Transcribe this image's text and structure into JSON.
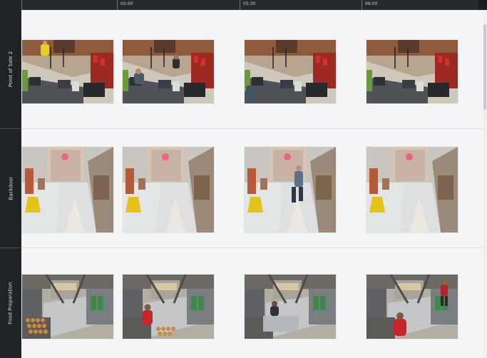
{
  "timeline": {
    "ticks": [
      {
        "label": ""
      },
      {
        "label": "05:00"
      },
      {
        "label": "05:30"
      },
      {
        "label": "06:00"
      }
    ]
  },
  "lanes": [
    {
      "label": "Point of Sale 2",
      "thumbnails": [
        {
          "scene": "point-of-sale",
          "people": [
            "yellow-shirt-customer"
          ]
        },
        {
          "scene": "point-of-sale",
          "people": [
            "cashier",
            "customer"
          ]
        },
        {
          "scene": "point-of-sale",
          "people": [
            "cashier-partial"
          ]
        },
        {
          "scene": "point-of-sale",
          "people": []
        }
      ]
    },
    {
      "label": "Backdoor",
      "thumbnails": [
        {
          "scene": "backdoor",
          "people": []
        },
        {
          "scene": "backdoor",
          "people": []
        },
        {
          "scene": "backdoor",
          "people": [
            "worker-walking"
          ]
        },
        {
          "scene": "backdoor",
          "people": []
        }
      ]
    },
    {
      "label": "Food Preparation",
      "thumbnails": [
        {
          "scene": "food-preparation",
          "people": []
        },
        {
          "scene": "food-preparation",
          "people": [
            "red-shirt-cook"
          ]
        },
        {
          "scene": "food-preparation",
          "people": [
            "cook-at-counter"
          ]
        },
        {
          "scene": "food-preparation",
          "people": [
            "red-shirt-cook",
            "red-shirt-worker"
          ]
        }
      ]
    }
  ],
  "colors": {
    "timeline_bg": "#262a2d",
    "sidebar_bg": "#1f2326",
    "canvas_bg": "#f4f5f6"
  }
}
